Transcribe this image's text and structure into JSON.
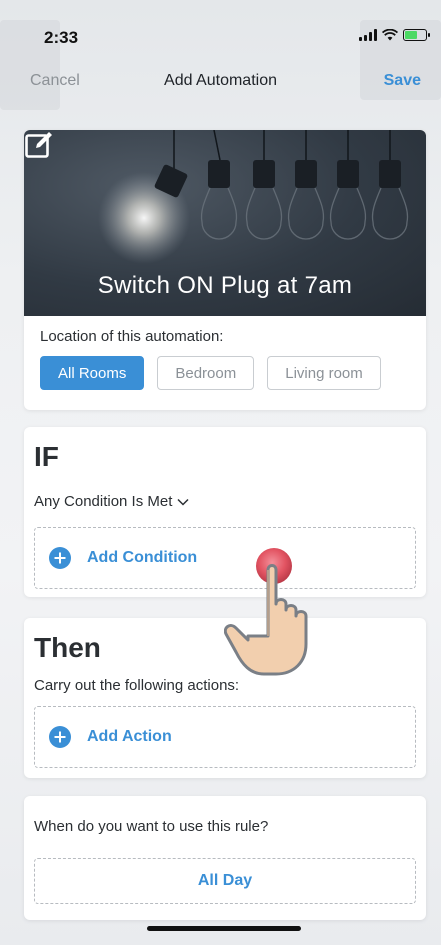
{
  "status_bar": {
    "time": "2:33"
  },
  "nav": {
    "cancel_label": "Cancel",
    "title": "Add Automation",
    "save_label": "Save"
  },
  "banner": {
    "title": "Switch ON Plug at 7am",
    "edit_icon": "edit-icon"
  },
  "location": {
    "label": "Location of this automation:",
    "rooms": [
      "All Rooms",
      "Bedroom",
      "Living room"
    ],
    "selected": "All Rooms"
  },
  "if_section": {
    "heading": "IF",
    "condition_mode": "Any Condition Is Met",
    "add_label": "Add Condition"
  },
  "then_section": {
    "heading": "Then",
    "subtitle": "Carry out the following actions:",
    "add_label": "Add Action"
  },
  "schedule": {
    "question": "When do you want to use this rule?",
    "value": "All Day"
  },
  "colors": {
    "accent": "#3a8fd6",
    "banner_bg": "#313a44",
    "tap_indicator": "#e14b5a"
  }
}
